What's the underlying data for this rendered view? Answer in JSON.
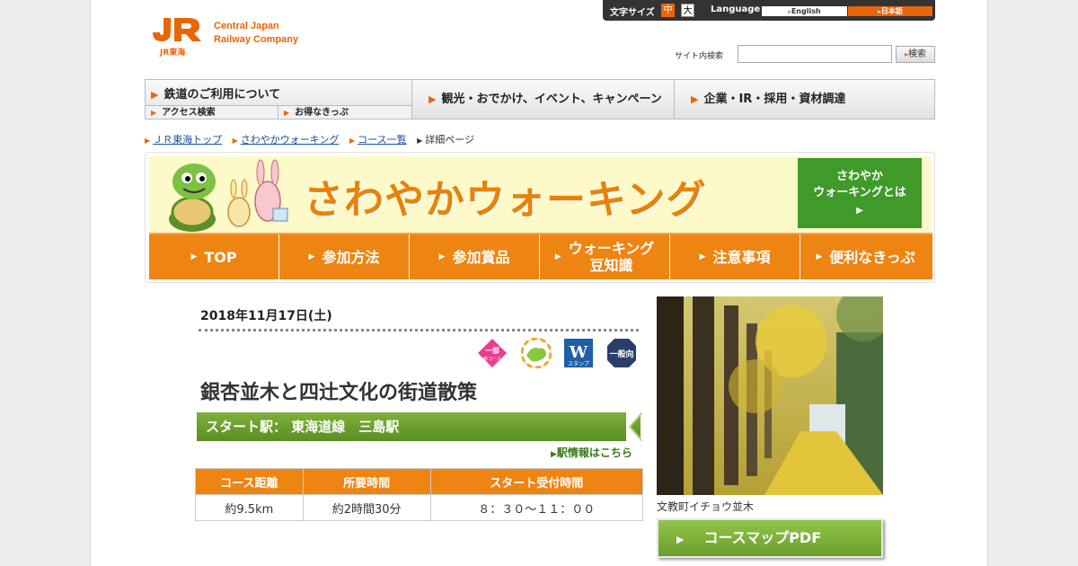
{
  "header": {
    "logo_line1": "Central Japan",
    "logo_line2": "Railway Company",
    "logo_small": "JR東海",
    "font_size_label": "文字サイズ",
    "font_size_medium": "中",
    "font_size_large": "大",
    "language_label": "Language",
    "lang_english": "English",
    "lang_japanese": "日本語",
    "search_label": "サイト内検索",
    "search_value": "",
    "search_button": "検索"
  },
  "nav": {
    "main1": "鉄道のご利用について",
    "sub1": "アクセス検索",
    "sub2": "お得なきっぷ",
    "main2": "観光・おでかけ、イベント、キャンペーン",
    "main3": "企業・IR・採用・資材調達"
  },
  "breadcrumb": {
    "item1": "ＪＲ東海トップ",
    "item2": "さわやかウォーキング",
    "item3": "コース一覧",
    "current": "詳細ページ"
  },
  "banner": {
    "title": "さわやかウォーキング",
    "about_line1": "さわやか",
    "about_line2": "ウォーキングとは",
    "menu": [
      {
        "label": "TOP"
      },
      {
        "label": "参加方法"
      },
      {
        "label": "参加賞品"
      },
      {
        "label1": "ウォーキング",
        "label2": "豆知識"
      },
      {
        "label": "注意事項"
      },
      {
        "label": "便利なきっぷ"
      }
    ]
  },
  "event": {
    "date": "2018年11月17日(土)",
    "badges": {
      "new_course_top": "一部",
      "new_course_bottom": "新コース",
      "stamp_label": "スタンプ",
      "general": "一般向"
    },
    "title": "銀杏並木と四辻文化の街道散策",
    "start_station": "スタート駅：  東海道線　三島駅",
    "station_link": "駅情報はこちら",
    "table_headers": [
      "コース距離",
      "所要時間",
      "スタート受付時間"
    ],
    "table_values": [
      "約9.5km",
      "約2時間30分",
      "８：３０～１１：００"
    ],
    "photo_caption": "文教町イチョウ並木",
    "pdf_button": "コースマップPDF"
  },
  "colors": {
    "brand_orange": "#ee8412",
    "green": "#5a8e23",
    "link_blue": "#1a4fa3"
  }
}
